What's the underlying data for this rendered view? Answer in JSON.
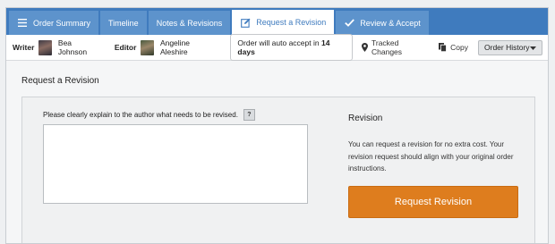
{
  "tabs": [
    {
      "label": "Order Summary",
      "icon": "menu-icon"
    },
    {
      "label": "Timeline",
      "icon": ""
    },
    {
      "label": "Notes & Revisions",
      "icon": ""
    },
    {
      "label": "Request a Revision",
      "icon": "edit-icon",
      "active": true
    },
    {
      "label": "Review & Accept",
      "icon": "checkmark-icon"
    }
  ],
  "infobar": {
    "writer_label": "Writer",
    "writer_name": "Bea Johnson",
    "editor_label": "Editor",
    "editor_name": "Angeline Aleshire",
    "auto_accept_prefix": "Order will auto accept in",
    "auto_accept_days": "14 days",
    "tracked_changes": "Tracked Changes",
    "copy": "Copy",
    "order_history": "Order History"
  },
  "section": {
    "title": "Request a Revision",
    "instruction": "Please clearly explain to the author what needs to be revised.",
    "help": "?",
    "textarea_value": ""
  },
  "revision": {
    "title": "Revision",
    "text": "You can request a revision for no extra cost. Your revision request should align with your original order instructions.",
    "button": "Request Revision"
  },
  "colors": {
    "tab_bar": "#3f7bbe",
    "tab_inactive": "#5d93cc",
    "button_accent": "#de7d1e"
  }
}
